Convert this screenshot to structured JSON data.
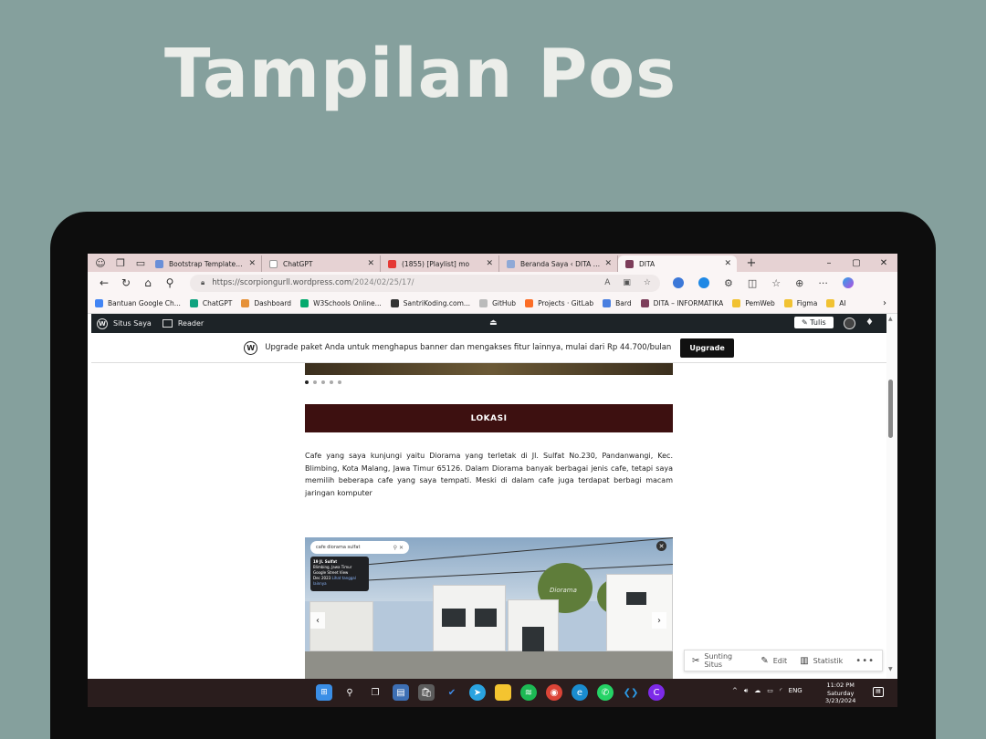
{
  "slide_title": "Tampilan Pos",
  "browser": {
    "tabs": [
      {
        "title": "Bootstrap Templates | Pre",
        "color": "#6a8fd8",
        "active": false
      },
      {
        "title": "ChatGPT",
        "color": "#ffffff",
        "active": false
      },
      {
        "title": "(1855) [Playlist] mo",
        "color": "#e53935",
        "active": false
      },
      {
        "title": "Beranda Saya ‹ DITA — W",
        "color": "#8fa9d6",
        "active": false
      },
      {
        "title": "DITA",
        "color": "#7d3d5a",
        "active": true
      }
    ],
    "window_controls": [
      "–",
      "▢",
      "✕"
    ],
    "new_tab": "+",
    "url_host": "https://scorpiongurll.wordpress.com",
    "url_path": "/2024/02/25/17/",
    "bookmarks": [
      {
        "label": "Bantuan Google Ch...",
        "color": "#4285f4"
      },
      {
        "label": "ChatGPT",
        "color": "#10a37f"
      },
      {
        "label": "Dashboard",
        "color": "#e69138"
      },
      {
        "label": "W3Schools Online...",
        "color": "#04aa6d"
      },
      {
        "label": "SantriKoding.com...",
        "color": "#333333"
      },
      {
        "label": "GitHub",
        "color": "#bbbbbb"
      },
      {
        "label": "Projects · GitLab",
        "color": "#fc6d26"
      },
      {
        "label": "Bard",
        "color": "#4a7fe0"
      },
      {
        "label": "DITA – INFORMATIKA",
        "color": "#7d3d5a"
      },
      {
        "label": "PemWeb",
        "color": "folder"
      },
      {
        "label": "Figma",
        "color": "folder"
      },
      {
        "label": "AI",
        "color": "folder"
      }
    ]
  },
  "wp_bar": {
    "site_label": "Situs Saya",
    "reader_label": "Reader",
    "write_label": "Tulis"
  },
  "banner": {
    "text": "Upgrade paket Anda untuk menghapus banner dan mengakses fitur lainnya, mulai dari Rp 44.700/bulan",
    "button": "Upgrade"
  },
  "post": {
    "section_heading": "LOKASI",
    "paragraph": "Cafe yang saya kunjungi yaitu Diorama yang terletak di Jl. Sulfat No.230, Pandanwangi, Kec. Blimbing, Kota Malang, Jawa Timur 65126. Dalam Diorama banyak berbagai jenis cafe, tetapi saya memilih beberapa cafe yang saya tempati. Meski di dalam cafe juga terdapat berbagi macam jaringan komputer",
    "slider_dots": 5,
    "slider_active": 0,
    "street_view": {
      "search_text": "cafe diorama sulfat",
      "card_title": "19 Jl. Sulfat",
      "card_sub": "Blimbing, Jawa Timur",
      "card_source": "Google Street View",
      "card_date": "Dec 2023",
      "card_link": "Lihat tanggal lainnya",
      "sign": "Diorama"
    }
  },
  "float_toolbar": {
    "edit_site": "Sunting Situs",
    "edit": "Edit",
    "stats": "Statistik",
    "more": "•••"
  },
  "taskbar": {
    "lang": "ENG",
    "time": "11:02 PM",
    "day": "Saturday",
    "date": "3/23/2024"
  }
}
